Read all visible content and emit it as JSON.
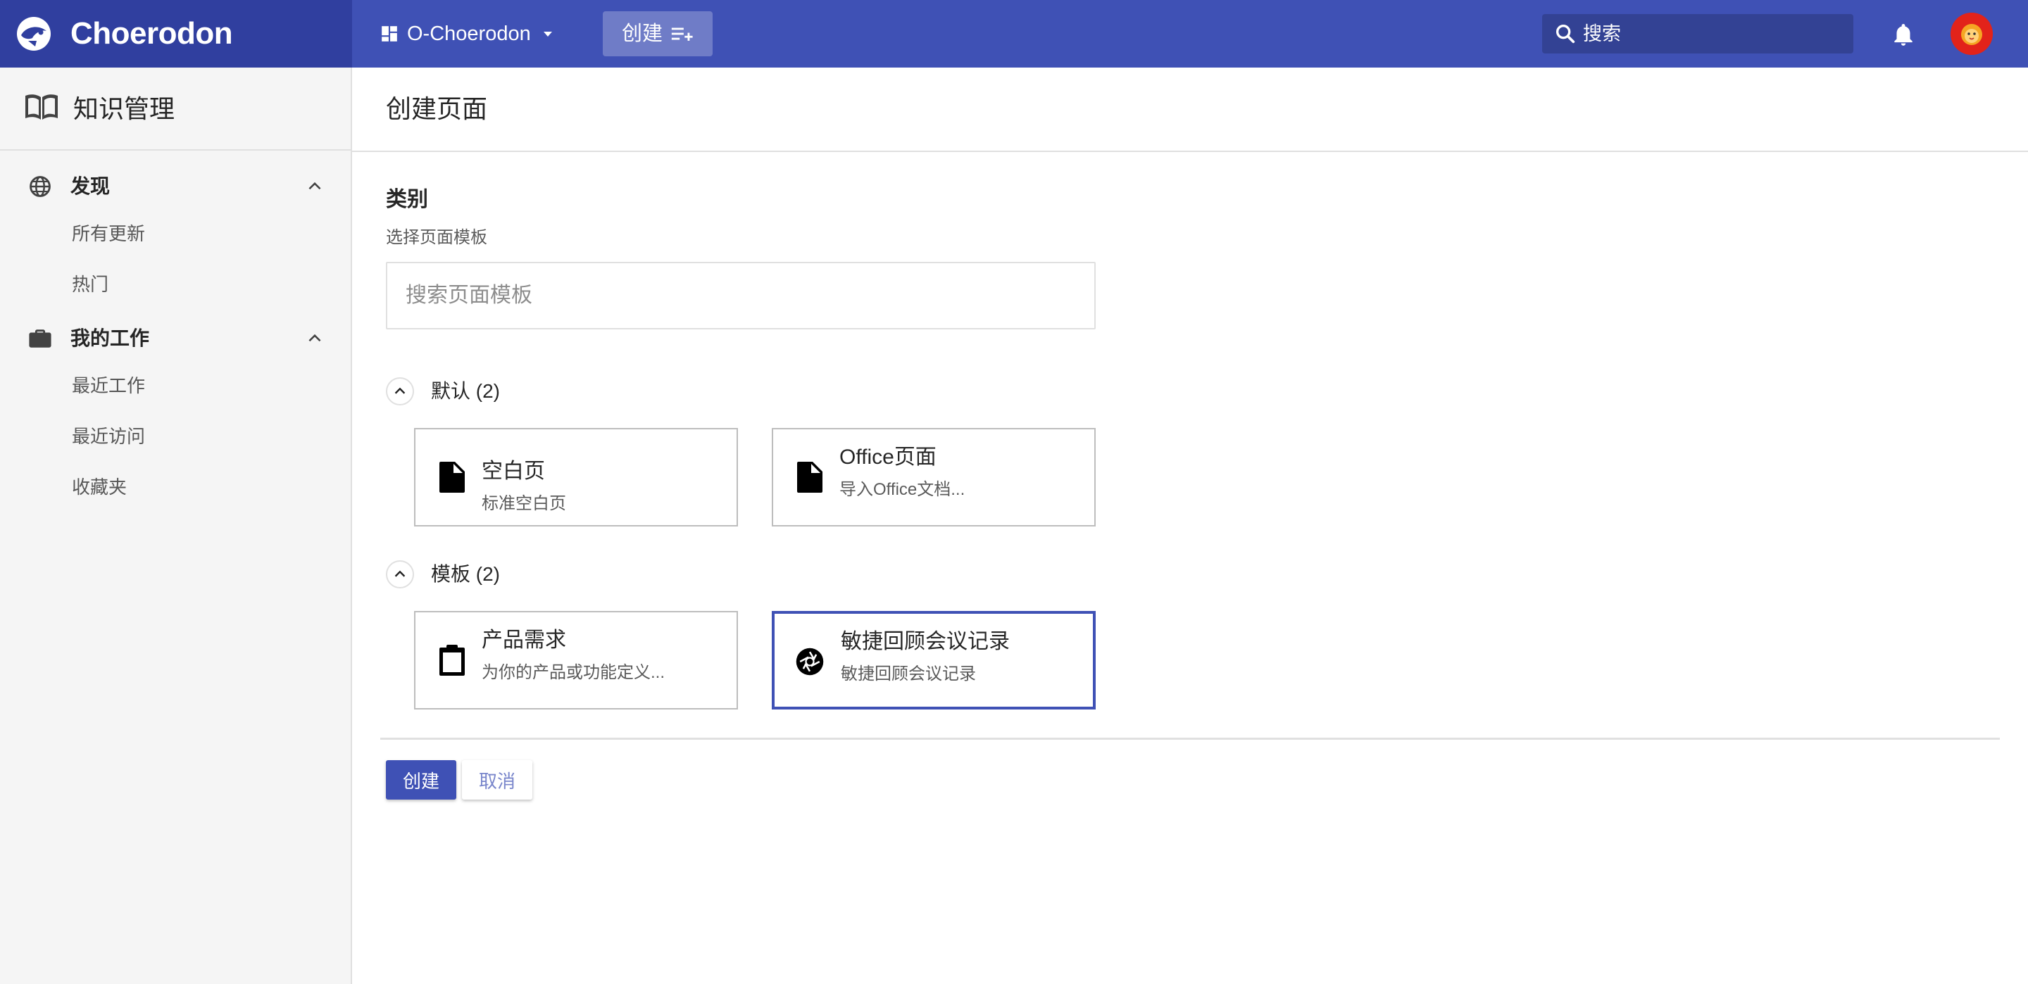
{
  "header": {
    "brand": "Choerodon",
    "org": "O-Choerodon",
    "create_label": "创建",
    "search_placeholder": "搜索",
    "avatar": "user-avatar"
  },
  "sidebar": {
    "title": "知识管理",
    "groups": [
      {
        "label": "发现",
        "icon": "globe-icon",
        "expanded": true,
        "items": [
          "所有更新",
          "热门"
        ]
      },
      {
        "label": "我的工作",
        "icon": "briefcase-icon",
        "expanded": true,
        "items": [
          "最近工作",
          "最近访问",
          "收藏夹"
        ]
      }
    ]
  },
  "main": {
    "page_title": "创建页面",
    "section_title": "类别",
    "field_label": "选择页面模板",
    "search_placeholder": "搜索页面模板",
    "groups": [
      {
        "label": "默认 (2)",
        "expanded": true,
        "cards": [
          {
            "title": "空白页",
            "desc": "标准空白页",
            "icon": "file-icon",
            "selected": false
          },
          {
            "title": "Office页面",
            "desc": "导入Office文档...",
            "icon": "file-icon",
            "selected": false
          }
        ]
      },
      {
        "label": "模板 (2)",
        "expanded": true,
        "cards": [
          {
            "title": "产品需求",
            "desc": "为你的产品或功能定义...",
            "icon": "clipboard-icon",
            "selected": false
          },
          {
            "title": "敏捷回顾会议记录",
            "desc": "敏捷回顾会议记录",
            "icon": "aperture-icon",
            "selected": true
          }
        ]
      }
    ],
    "buttons": {
      "create": "创建",
      "cancel": "取消"
    }
  },
  "colors": {
    "primary": "#3f51b5",
    "primary_dark": "#303f9f",
    "avatar_bg": "#e2231a"
  }
}
